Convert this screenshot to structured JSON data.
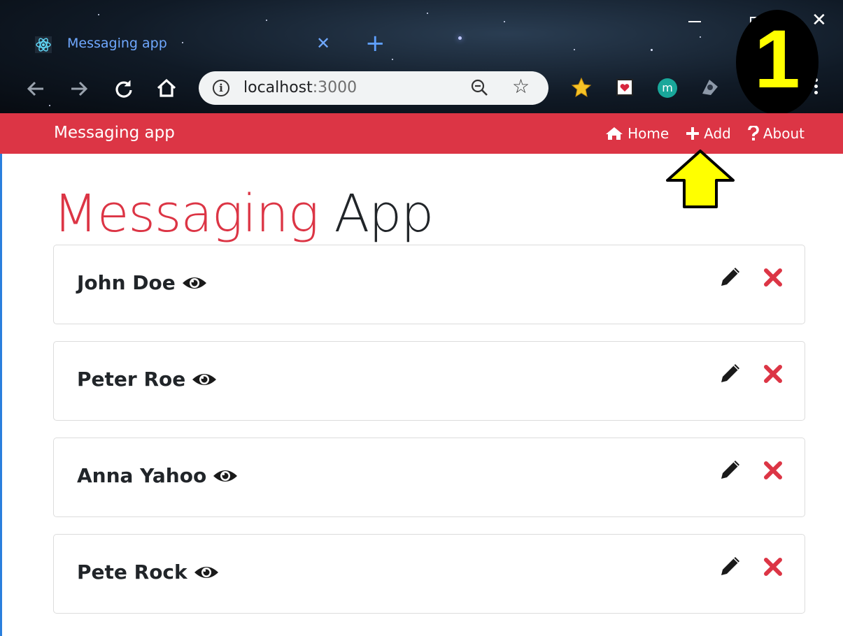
{
  "browser": {
    "tab_title": "Messaging app",
    "url_host": "localhost",
    "url_port": ":3000",
    "new_tab_symbol": "+",
    "tab_close_symbol": "✕",
    "window_close_symbol": "✕"
  },
  "annotation": {
    "step_number": "1",
    "badge_color": "#000000",
    "number_color": "#ffff00",
    "arrow_color": "#ffff00"
  },
  "navbar": {
    "brand": "Messaging app",
    "color": "#dc3545",
    "links": [
      {
        "label": "Home",
        "icon": "home-icon"
      },
      {
        "label": "Add",
        "icon": "plus-icon"
      },
      {
        "label": "About",
        "icon": "question-icon"
      }
    ]
  },
  "main": {
    "title_part1": "Messaging",
    "title_part2": "App",
    "messages": [
      {
        "name": "John Doe"
      },
      {
        "name": "Peter Roe"
      },
      {
        "name": "Anna Yahoo"
      },
      {
        "name": "Pete Rock"
      }
    ]
  }
}
